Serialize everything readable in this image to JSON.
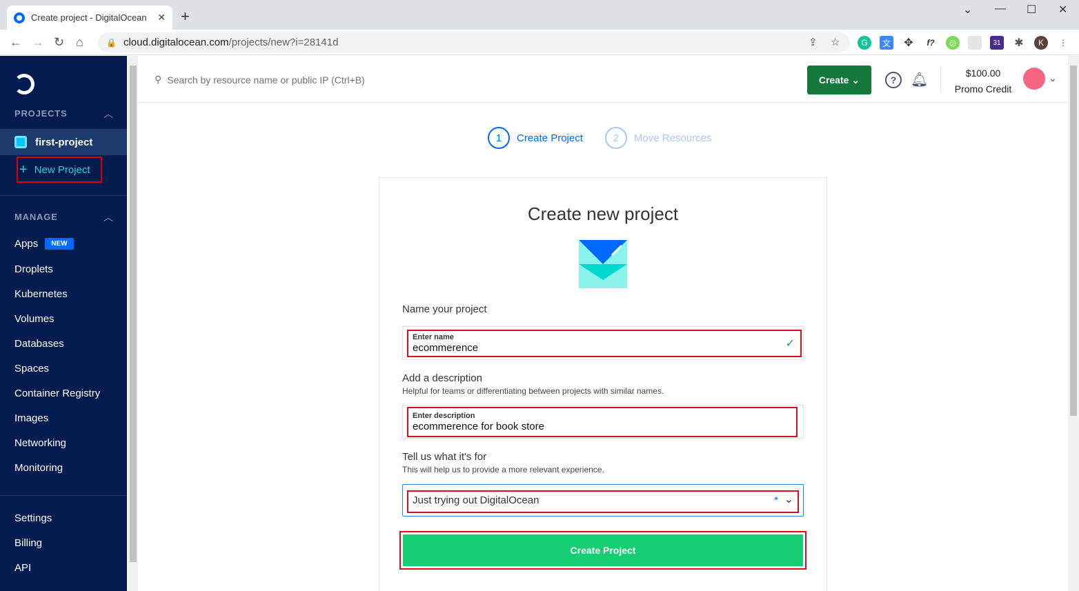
{
  "browser": {
    "tab_title": "Create project - DigitalOcean",
    "tab_close": "✕",
    "new_tab": "+",
    "url_host": "cloud.digitalocean.com",
    "url_path": "/projects/new?i=28141d",
    "profile_initial": "K",
    "ext_badge": "31",
    "window_controls": [
      "⌄",
      "—",
      "☐",
      "✕"
    ]
  },
  "sidebar": {
    "projects_title": "PROJECTS",
    "current_project": "first-project",
    "new_project": "New Project",
    "manage_title": "MANAGE",
    "apps_badge": "NEW",
    "manage_items": [
      "Apps",
      "Droplets",
      "Kubernetes",
      "Volumes",
      "Databases",
      "Spaces",
      "Container Registry",
      "Images",
      "Networking",
      "Monitoring"
    ],
    "bottom_items": [
      "Settings",
      "Billing",
      "API"
    ]
  },
  "topbar": {
    "search_placeholder": "Search by resource name or public IP (Ctrl+B)",
    "create_label": "Create",
    "credit_amount": "$100.00",
    "credit_label": "Promo Credit"
  },
  "steps": [
    {
      "num": "1",
      "label": "Create Project",
      "active": true
    },
    {
      "num": "2",
      "label": "Move Resources",
      "active": false
    }
  ],
  "form": {
    "title": "Create new project",
    "name_section": "Name your project",
    "name_label": "Enter name",
    "name_value": "ecommerence",
    "desc_section": "Add a description",
    "desc_help": "Helpful for teams or differentiating between projects with similar names.",
    "desc_label": "Enter description",
    "desc_value": "ecommerence for book store",
    "purpose_section": "Tell us what it's for",
    "purpose_help": "This will help us to provide a more relevant experience.",
    "purpose_value": "Just trying out DigitalOcean",
    "purpose_required": "*",
    "submit_label": "Create Project"
  },
  "colors": {
    "sidebar_bg": "#031b4e",
    "primary_blue": "#0069ff",
    "create_green": "#15783b",
    "submit_green": "#15cd72",
    "highlight_red": "#d8101c"
  }
}
